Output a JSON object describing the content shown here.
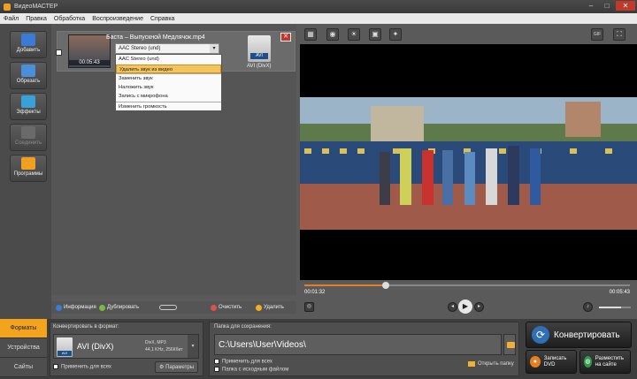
{
  "window": {
    "title": "ВидеоМАСТЕР"
  },
  "menu": [
    "Файл",
    "Правка",
    "Обработка",
    "Воспроизведение",
    "Справка"
  ],
  "left_tools": [
    {
      "label": "Добавить",
      "icon": "add-file-icon",
      "color": "#3a7bd5"
    },
    {
      "label": "Обрезать",
      "icon": "trim-icon",
      "color": "#4a90d9"
    },
    {
      "label": "Эффекты",
      "icon": "effects-icon",
      "color": "#3aa0d8"
    },
    {
      "label": "Соединить",
      "icon": "join-icon",
      "color": "#6a6a6a"
    },
    {
      "label": "Программы",
      "icon": "programs-icon",
      "color": "#f0a020"
    }
  ],
  "file": {
    "name": "Баста – Выпускной Медлячок.mp4",
    "duration": "00:05:43",
    "audio_track": "AAC Stereo (und)",
    "output_format": "AVI (DivX)",
    "format_badge": "AVI"
  },
  "audio_menu": {
    "options": [
      "AAC Stereo (und)",
      "Удалить звук из видео",
      "Заменить звук",
      "Наложить звук",
      "Запись с микрофона",
      "Изменить громкость"
    ],
    "highlighted": "Удалить звук из видео"
  },
  "list_actions": {
    "info": "Информация",
    "duplicate": "Дублировать",
    "clear": "Очистить",
    "delete": "Удалить"
  },
  "player": {
    "current_time": "00:01:32",
    "total_time": "00:05:43",
    "progress": 0.25,
    "volume": 0.7
  },
  "bottom_tabs": [
    "Форматы",
    "Устройства",
    "Сайты"
  ],
  "format_panel": {
    "label": "Конвертировать в формат:",
    "format": "AVI (DivX)",
    "badge": "AVI",
    "spec_line1": "DivX, MP3",
    "spec_line2": "44,1 KHz, 256Кбит",
    "apply_all": "Применить для всех",
    "params": "Параметры"
  },
  "save_panel": {
    "label": "Папка для сохранения:",
    "path": "C:\\Users\\User\\Videos\\",
    "apply_all": "Применить для всех",
    "source_folder": "Папка с исходным файлом",
    "open_folder": "Открыть папку"
  },
  "actions": {
    "convert": "Конвертировать",
    "dvd": "Записать DVD",
    "web": "Разместить на сайте"
  }
}
